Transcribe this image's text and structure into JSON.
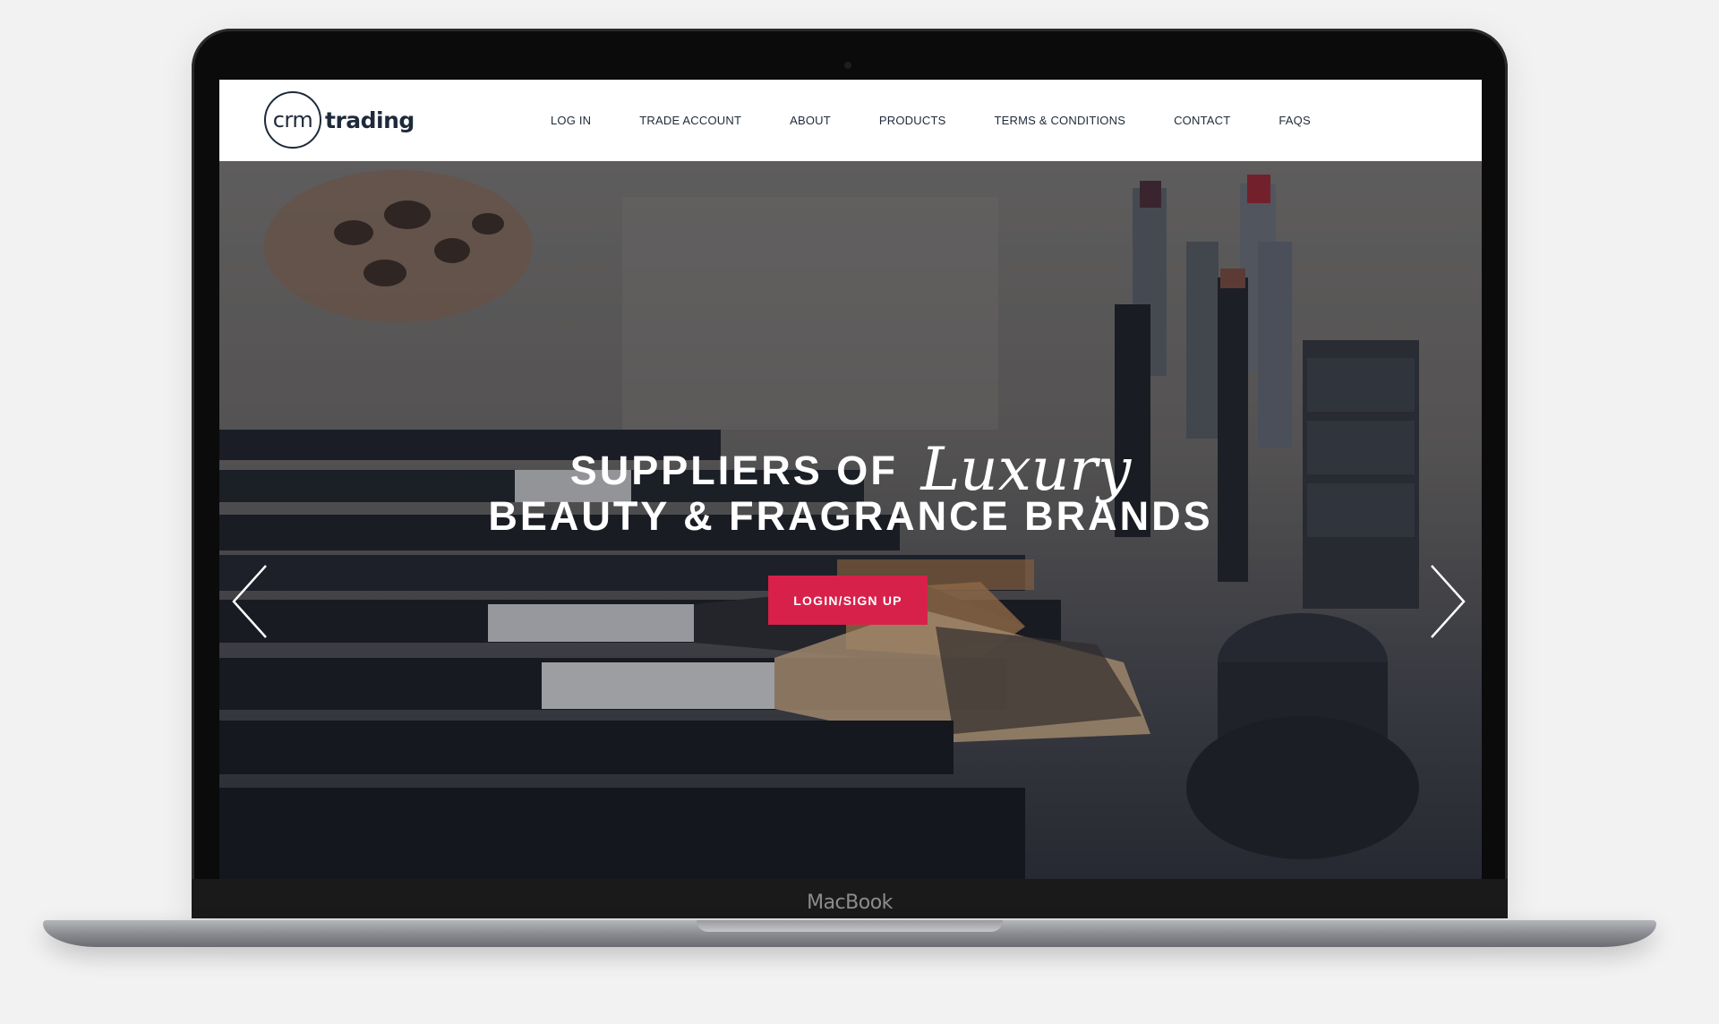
{
  "device": {
    "brand_label": "MacBook"
  },
  "logo": {
    "crm": "crm",
    "trading": "trading"
  },
  "nav": {
    "items": [
      {
        "label": "LOG IN"
      },
      {
        "label": "TRADE ACCOUNT"
      },
      {
        "label": "ABOUT"
      },
      {
        "label": "PRODUCTS"
      },
      {
        "label": "TERMS & CONDITIONS"
      },
      {
        "label": "CONTACT"
      },
      {
        "label": "FAQS"
      }
    ]
  },
  "hero": {
    "line1_prefix": "SUPPLIERS OF",
    "line1_script": "Luxury",
    "line2": "BEAUTY & FRAGRANCE BRANDS",
    "cta_label": "LOGIN/SIGN UP",
    "prev_icon": "chevron-left-icon",
    "next_icon": "chevron-right-icon"
  },
  "colors": {
    "accent": "#d8214a",
    "navy": "#1e2a3a",
    "frame": "#0b0b0b"
  }
}
